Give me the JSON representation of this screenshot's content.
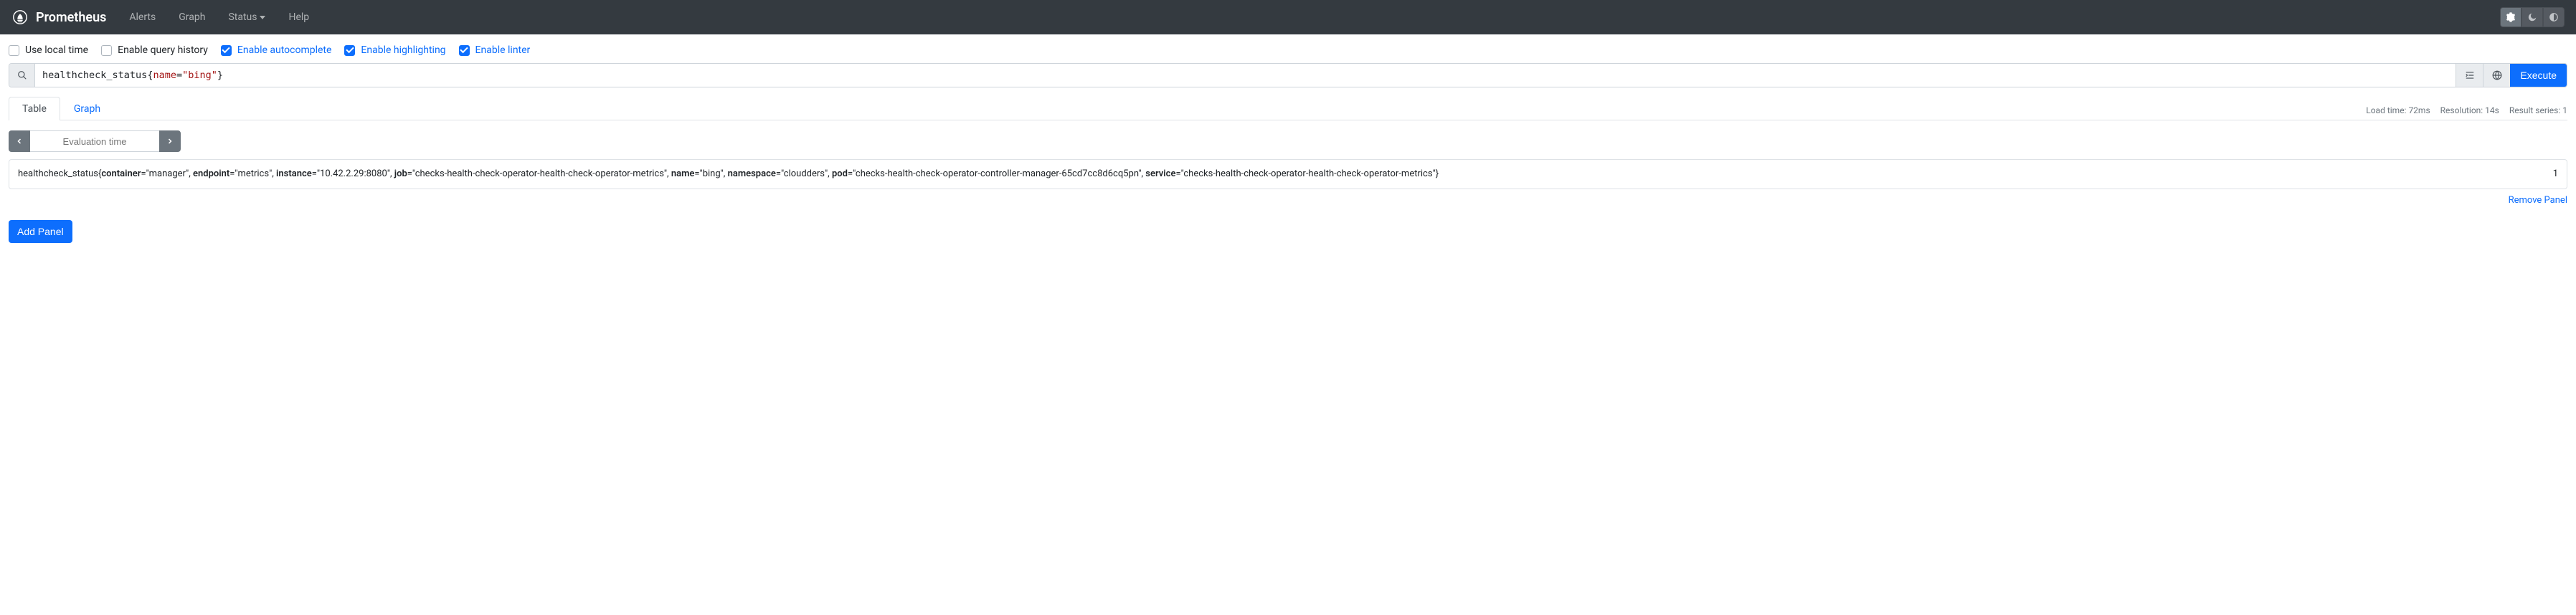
{
  "navbar": {
    "brand": "Prometheus",
    "links": {
      "alerts": "Alerts",
      "graph": "Graph",
      "status": "Status",
      "help": "Help"
    }
  },
  "options": {
    "use_local_time": {
      "label": "Use local time",
      "checked": false
    },
    "enable_query_history": {
      "label": "Enable query history",
      "checked": false
    },
    "enable_autocomplete": {
      "label": "Enable autocomplete",
      "checked": true
    },
    "enable_highlighting": {
      "label": "Enable highlighting",
      "checked": true
    },
    "enable_linter": {
      "label": "Enable linter",
      "checked": true
    }
  },
  "query": {
    "metric": "healthcheck_status",
    "open": "{",
    "label": "name",
    "eq": "=",
    "value": "\"bing\"",
    "close": "}",
    "execute_label": "Execute"
  },
  "tabs": {
    "table": "Table",
    "graph": "Graph"
  },
  "stats": {
    "load_time": "Load time: 72ms",
    "resolution": "Resolution: 14s",
    "series": "Result series: 1"
  },
  "eval": {
    "placeholder": "Evaluation time"
  },
  "result": {
    "metric": "healthcheck_status",
    "labels": [
      {
        "k": "container",
        "v": "manager"
      },
      {
        "k": "endpoint",
        "v": "metrics"
      },
      {
        "k": "instance",
        "v": "10.42.2.29:8080"
      },
      {
        "k": "job",
        "v": "checks-health-check-operator-health-check-operator-metrics"
      },
      {
        "k": "name",
        "v": "bing"
      },
      {
        "k": "namespace",
        "v": "cloudders"
      },
      {
        "k": "pod",
        "v": "checks-health-check-operator-controller-manager-65cd7cc8d6cq5pn"
      },
      {
        "k": "service",
        "v": "checks-health-check-operator-health-check-operator-metrics"
      }
    ],
    "value": "1"
  },
  "actions": {
    "remove_panel": "Remove Panel",
    "add_panel": "Add Panel"
  }
}
